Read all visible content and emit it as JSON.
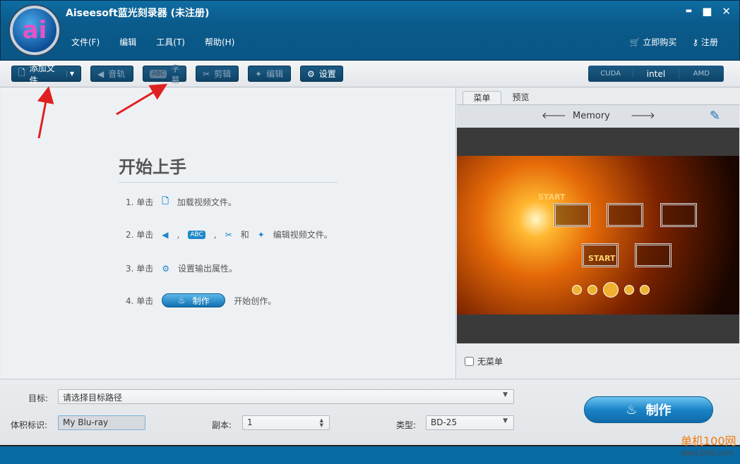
{
  "app": {
    "title": "Aiseesoft蓝光刻录器 (未注册)",
    "logo_text": "ai",
    "minimize": "▬",
    "maximize": "■",
    "close": "✕"
  },
  "menu": [
    "文件(F)",
    "编辑",
    "工具(T)",
    "帮助(H)"
  ],
  "header_links": {
    "buy": "立即购买",
    "register": "注册"
  },
  "toolbar": {
    "add_file": "添加文件",
    "audio": "音轨",
    "subtitle": "字幕",
    "clip": "剪辑",
    "edit": "编辑",
    "settings": "设置",
    "abc_icon": "ABC"
  },
  "hw": [
    "CUDA",
    "intel",
    "AMD"
  ],
  "getting_started": {
    "title": "开始上手",
    "step1": {
      "prefix": "1. 单击",
      "text": "加载视频文件。"
    },
    "step2": {
      "prefix": "2. 单击",
      "comma": ",",
      "and": "和",
      "text": "编辑视频文件。"
    },
    "step3": {
      "prefix": "3. 单击",
      "text": "设置输出属性。"
    },
    "step4": {
      "prefix": "4. 单击",
      "button": "制作",
      "text": "开始创作。"
    }
  },
  "menu_panel": {
    "tabs": [
      "菜单",
      "预览"
    ],
    "template": "Memory",
    "no_menu": "无菜单",
    "no_menu_checked": false,
    "preview_start": "START"
  },
  "bottom": {
    "target_label": "目标:",
    "target_value": "请选择目标路径",
    "volume_label": "体积标识:",
    "volume_value": "My Blu-ray",
    "copies_label": "副本:",
    "copies_value": "1",
    "type_label": "类型:",
    "type_value": "BD-25",
    "create": "制作"
  },
  "watermark": {
    "name": "单机100网",
    "url": "danji100.com"
  },
  "colors": {
    "accent": "#0a6aa3",
    "annotation_arrow": "#e02020"
  }
}
